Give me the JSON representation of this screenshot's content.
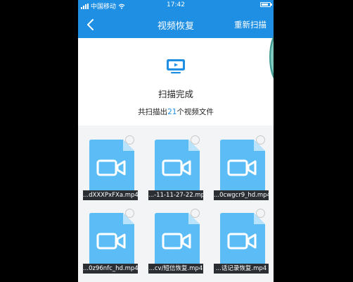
{
  "statusbar": {
    "carrier": "中国移动",
    "time": "17:42"
  },
  "navbar": {
    "title": "视频恢复",
    "rescan_label": "重新扫描"
  },
  "summary": {
    "status": "扫描完成",
    "count_prefix": "共扫描出",
    "count_value": "21",
    "count_suffix": "个视频文件"
  },
  "files": [
    {
      "name": "...dXXXPxFXa.mp4"
    },
    {
      "name": "...-11-11-27-22.mp4"
    },
    {
      "name": "...0cwgcr9_hd.mp4"
    },
    {
      "name": "...0z96nfc_hd.mp4"
    },
    {
      "name": "...cv/短信恢复.mp4"
    },
    {
      "name": "...话记录恢复.mp4"
    }
  ],
  "colors": {
    "accent": "#1e8fe3",
    "file_icon": "#5cbcf5",
    "label_bg": "#2b2f33"
  }
}
